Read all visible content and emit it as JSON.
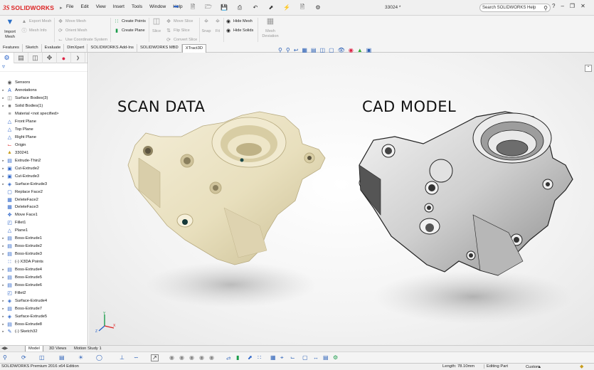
{
  "app": {
    "brand_ds": "3S",
    "brand_name": "SOLIDWORKS",
    "document_title": "33024 *"
  },
  "menu": [
    "File",
    "Edit",
    "View",
    "Insert",
    "Tools",
    "Window",
    "Help"
  ],
  "search": {
    "placeholder": "Search SOLIDWORKS Help"
  },
  "command_manager": {
    "import_mesh": "Import Mesh",
    "export_mesh": "Export Mesh",
    "mesh_info": "Mesh Info",
    "move_mesh": "Move Mesh",
    "orient_mesh": "Orient Mesh",
    "use_coordinate_system": "Use Coordinate System",
    "create_points": "Create Points",
    "create_plane": "Create Plane",
    "slice": "Slice",
    "move_slice": "Move Slice",
    "flip_slice": "Flip Slice",
    "convert_slice": "Convert Slice",
    "snap": "Snap",
    "fit": "Fit",
    "hide_mesh": "Hide Mesh",
    "hide_solids": "Hide Solids",
    "mesh_deviation": "Mesh Deviation"
  },
  "tabs": [
    "Features",
    "Sketch",
    "Evaluate",
    "DimXpert",
    "SOLIDWORKS Add-Ins",
    "SOLIDWORKS MBD",
    "XTract3D"
  ],
  "active_tab": "XTract3D",
  "feature_tree": [
    {
      "label": "Sensors",
      "expand": false,
      "icon": "sensor-icon"
    },
    {
      "label": "Annotations",
      "expand": true,
      "icon": "annotation-icon"
    },
    {
      "label": "Surface Bodies(3)",
      "expand": true,
      "icon": "surface-bodies-icon"
    },
    {
      "label": "Solid Bodies(1)",
      "expand": true,
      "icon": "solid-bodies-icon"
    },
    {
      "label": "Material <not specified>",
      "expand": false,
      "icon": "material-icon"
    },
    {
      "label": "Front Plane",
      "expand": false,
      "icon": "plane-icon"
    },
    {
      "label": "Top Plane",
      "expand": false,
      "icon": "plane-icon"
    },
    {
      "label": "Right Plane",
      "expand": false,
      "icon": "plane-icon"
    },
    {
      "label": "Origin",
      "expand": false,
      "icon": "origin-icon"
    },
    {
      "label": "330241",
      "expand": false,
      "icon": "mesh-icon"
    },
    {
      "label": "Extrude-Thin2",
      "expand": true,
      "icon": "extrude-icon"
    },
    {
      "label": "Cut-Extrude2",
      "expand": true,
      "icon": "cut-icon"
    },
    {
      "label": "Cut-Extrude3",
      "expand": true,
      "icon": "cut-icon"
    },
    {
      "label": "Surface-Extrude3",
      "expand": true,
      "icon": "surface-icon"
    },
    {
      "label": "Replace Face2",
      "expand": false,
      "icon": "replace-face-icon"
    },
    {
      "label": "DeleteFace2",
      "expand": false,
      "icon": "delete-face-icon"
    },
    {
      "label": "DeleteFace3",
      "expand": false,
      "icon": "delete-face-icon"
    },
    {
      "label": "Move Face1",
      "expand": false,
      "icon": "move-face-icon"
    },
    {
      "label": "Fillet1",
      "expand": false,
      "icon": "fillet-icon"
    },
    {
      "label": "Plane1",
      "expand": false,
      "icon": "plane-icon"
    },
    {
      "label": "Boss-Extrude1",
      "expand": true,
      "icon": "extrude-icon"
    },
    {
      "label": "Boss-Extrude2",
      "expand": true,
      "icon": "extrude-icon"
    },
    {
      "label": "Boss-Extrude3",
      "expand": true,
      "icon": "extrude-icon"
    },
    {
      "label": "(-) X3DA Points",
      "expand": false,
      "icon": "points-icon"
    },
    {
      "label": "Boss-Extrude4",
      "expand": true,
      "icon": "extrude-icon"
    },
    {
      "label": "Boss-Extrude5",
      "expand": true,
      "icon": "extrude-icon"
    },
    {
      "label": "Boss-Extrude6",
      "expand": true,
      "icon": "extrude-icon"
    },
    {
      "label": "Fillet2",
      "expand": false,
      "icon": "fillet-icon"
    },
    {
      "label": "Surface-Extrude4",
      "expand": true,
      "icon": "surface-icon"
    },
    {
      "label": "Boss-Extrude7",
      "expand": true,
      "icon": "extrude-icon"
    },
    {
      "label": "Surface-Extrude5",
      "expand": true,
      "icon": "surface-icon"
    },
    {
      "label": "Boss-Extrude8",
      "expand": true,
      "icon": "extrude-icon"
    },
    {
      "label": "(-) Sketch32",
      "expand": true,
      "icon": "sketch-icon"
    }
  ],
  "viewport": {
    "label_scan": "SCAN DATA",
    "label_cad": "CAD MODEL"
  },
  "bottom_tabs": [
    "Model",
    "3D Views",
    "Motion Study 1"
  ],
  "active_bottom_tab": "Model",
  "status": {
    "edition": "SOLIDWORKS Premium 2016 x64 Edition",
    "length": "Length: 78.10mm",
    "mode": "Editing Part",
    "units": "Custom"
  },
  "colors": {
    "scan": "#ece3c2",
    "cad": "#c9c9c9",
    "accent": "#2a63c9",
    "brand": "#d22222"
  }
}
